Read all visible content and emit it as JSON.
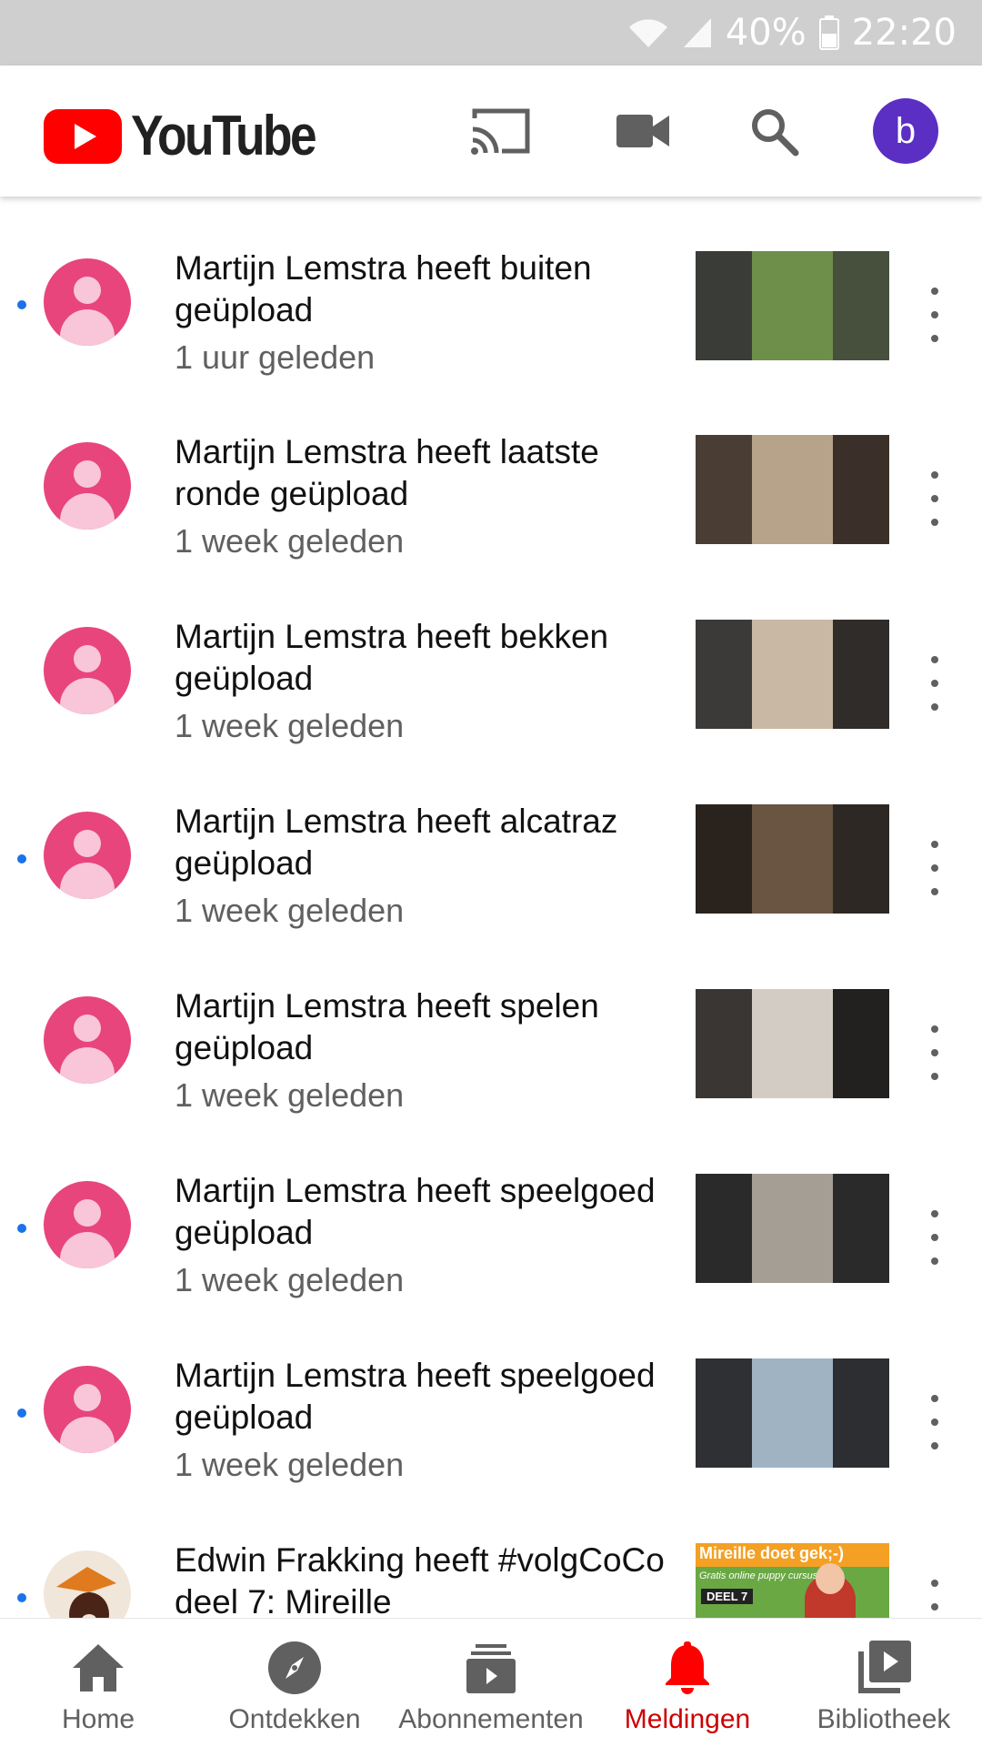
{
  "status_bar": {
    "battery": "40%",
    "time": "22:20"
  },
  "app_bar": {
    "logo_text": "YouTube",
    "account_initial": "b"
  },
  "colors": {
    "brand_red": "#ff0000",
    "avatar_pink": "#e8457d",
    "account_purple": "#5b2ec4",
    "unread_dot": "#1a73e8",
    "active_nav": "#cc0000"
  },
  "notifications": [
    {
      "title": "Martijn Lemstra heeft buiten geüpload",
      "time": "1 uur geleden",
      "unread": true
    },
    {
      "title": "Martijn Lemstra heeft laatste ronde geüpload",
      "time": "1 week geleden",
      "unread": false
    },
    {
      "title": "Martijn Lemstra heeft bekken geüpload",
      "time": "1 week geleden",
      "unread": false
    },
    {
      "title": "Martijn Lemstra heeft alcatraz geüpload",
      "time": "1 week geleden",
      "unread": true
    },
    {
      "title": "Martijn Lemstra heeft spelen geüpload",
      "time": "1 week geleden",
      "unread": false
    },
    {
      "title": "Martijn Lemstra heeft speelgoed geüpload",
      "time": "1 week geleden",
      "unread": true
    },
    {
      "title": "Martijn Lemstra heeft speelgoed geüpload",
      "time": "1 week geleden",
      "unread": true
    },
    {
      "title": "Edwin Frakking heeft #volgCoCo deel 7: Mireille",
      "time": "",
      "unread": true
    }
  ],
  "last_thumbnail_text": {
    "headline": "Mireille doet gek;-)",
    "sub": "Gratis online puppy cursus",
    "tag": "DEEL 7"
  },
  "bottom_nav": [
    {
      "label": "Home",
      "icon": "home-icon"
    },
    {
      "label": "Ontdekken",
      "icon": "compass-icon"
    },
    {
      "label": "Abonnementen",
      "icon": "subscriptions-icon"
    },
    {
      "label": "Meldingen",
      "icon": "bell-icon",
      "active": true
    },
    {
      "label": "Bibliotheek",
      "icon": "library-icon"
    }
  ]
}
